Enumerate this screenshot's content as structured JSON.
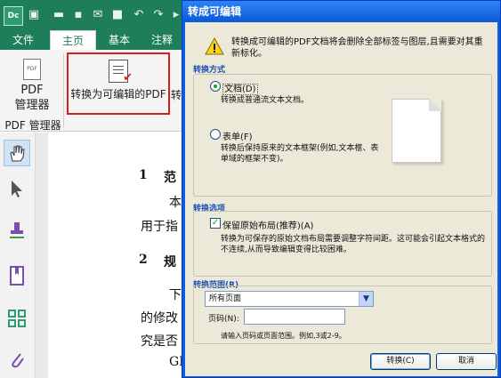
{
  "app": {
    "logo_text": "Dc",
    "ribbon_tabs": [
      "文件",
      "主页",
      "基本",
      "注释"
    ],
    "active_tab": "主页",
    "pdf_manager": {
      "button_line1": "PDF",
      "button_line2": "管理器",
      "group_label": "PDF 管理器"
    },
    "convert_button_label": "转换为可编辑的PDF",
    "clipped_text": "转",
    "tools": [
      "hand-tool",
      "select-tool",
      "stamp-tool",
      "bookmark-tool",
      "thumbnails-tool",
      "attachment-tool"
    ],
    "document_lines": {
      "h1_num": "1",
      "h1_text": "范",
      "p1a": "本",
      "p1b": "用于指",
      "h2_num": "2",
      "h2_text": "规",
      "p2a": "下",
      "p2b": "的修改",
      "p2c": "究是否",
      "p2d": "GE"
    }
  },
  "dialog": {
    "title": "转成可编辑",
    "warning": "转换成可编辑的PDF文档将会删除全部标签与图层,且需要对其重新标化。",
    "conversion_method": {
      "section_label": "转换方式",
      "options": [
        {
          "label": "文档(D)",
          "description": "转换成普通流文本文档。",
          "selected": true
        },
        {
          "label": "表单(F)",
          "description": "转换后保持原来的文本框架(例如,文本框、表单域的框架不变)。",
          "selected": false
        }
      ]
    },
    "conversion_options": {
      "section_label": "转换选项",
      "checkbox_label": "保留原始布局(推荐)(A)",
      "checked": true,
      "description": "转换为可保存的原始文档布局需要调整字符间距。这可能会引起文本格式的不连续,从而导致编辑变得比较困难。"
    },
    "range": {
      "section_label": "转换范围(R)",
      "selected": "所有页面",
      "pages_label": "页码(N):",
      "pages_value": "",
      "hint": "请输入页码或页面范围。例如,3或2-9。"
    },
    "buttons": {
      "convert": "转换(C)",
      "cancel": "取消"
    }
  },
  "colors": {
    "ribbon_green": "#1e7e5a",
    "highlight_red": "#d42020",
    "dialog_blue": "#0a5fe0",
    "dialog_face": "#ece9d8",
    "section_blue": "#1d4fb8"
  }
}
